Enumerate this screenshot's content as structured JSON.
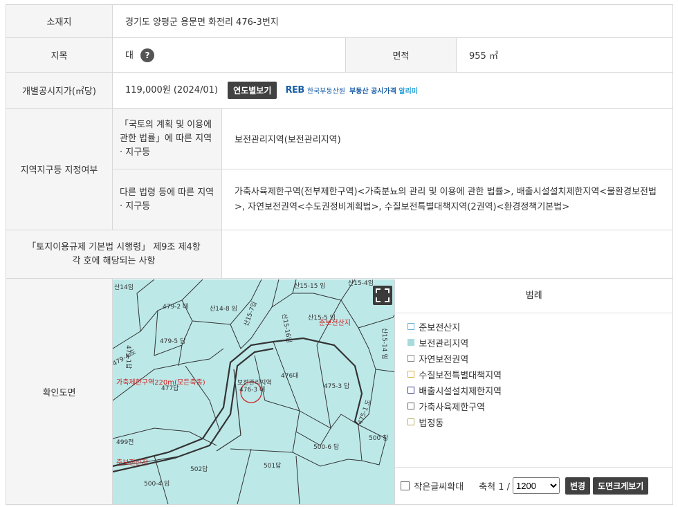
{
  "location": {
    "label": "소재지",
    "value": "경기도 양평군 용문면 화전리 476-3번지"
  },
  "jimok": {
    "label": "지목",
    "value": "대",
    "help_icon": "?"
  },
  "area": {
    "label": "면적",
    "value": "955 ㎡"
  },
  "price": {
    "label": "개별공시지가(㎡당)",
    "value": "119,000원 (2024/01)",
    "by_year_button": "연도별보기",
    "reb_logo": "REB",
    "reb_org": "한국부동산원",
    "reb_service": "부동산 공시가격",
    "reb_service_accent": "알리미"
  },
  "zoning": {
    "label": "지역지구등 지정여부",
    "national_law_label": "「국토의 계획 및 이용에 관한 법률」에 따른 지역 · 지구등",
    "national_law_value": "보전관리지역(보전관리지역)",
    "other_law_label": "다른 법령 등에 따른 지역 · 지구등",
    "other_law_value": "가축사육제한구역(전부제한구역)<가축분뇨의 관리 및 이용에 관한 법률>, 배출시설설치제한지역<물환경보전법>, 자연보전권역<수도권정비계획법>, 수질보전특별대책지역(2권역)<환경정책기본법>"
  },
  "land_regulation": {
    "label": "「토지이용규제 기본법 시행령」 제9조 제4항 각 호에 해당되는 사항",
    "value": ""
  },
  "map": {
    "label": "확인도면",
    "parcel_labels": [
      "산14임",
      "479-2 대",
      "산14-8 임",
      "산15-15 임",
      "산15-4임",
      "479-1답",
      "479-4 도",
      "479-5 답",
      "산15-5 임",
      "산15-14 임",
      "477답",
      "476대",
      "475-3 답",
      "500 창",
      "499전",
      "500-6 답",
      "502답",
      "501답",
      "500-4 임",
      "산15-7임",
      "산15-16임",
      "475-1 도",
      "476-3 대"
    ],
    "overlay_labels": [
      "준보전산지",
      "가축제한구역220m(모든축종)",
      "보전관리지역",
      "보전관리지역",
      "준보전산지"
    ],
    "selected_parcel": "476-3 대",
    "colors": {
      "land": "#bde8e8",
      "boundary": "#333333",
      "marker": "#d02020"
    }
  },
  "legend": {
    "title": "범례",
    "items": [
      {
        "label": "준보전산지",
        "color": "#6ab0d8",
        "fill": ""
      },
      {
        "label": "보전관리지역",
        "color": "#a8dcdc",
        "fill": "#a8dcdc"
      },
      {
        "label": "자연보전권역",
        "color": "#888888",
        "fill": ""
      },
      {
        "label": "수질보전특별대책지역",
        "color": "#d8b440",
        "fill": ""
      },
      {
        "label": "배출시설설치제한지역",
        "color": "#3a3a8a",
        "fill": ""
      },
      {
        "label": "가축사육제한구역",
        "color": "#666666",
        "fill": ""
      },
      {
        "label": "법정동",
        "color": "#b8a860",
        "fill": ""
      }
    ]
  },
  "controls": {
    "small_text_zoom": "작은글씨확대",
    "scale_label": "축척 1 /",
    "scale_value": "1200",
    "change_button": "변경",
    "enlarge_button": "도면크게보기"
  }
}
